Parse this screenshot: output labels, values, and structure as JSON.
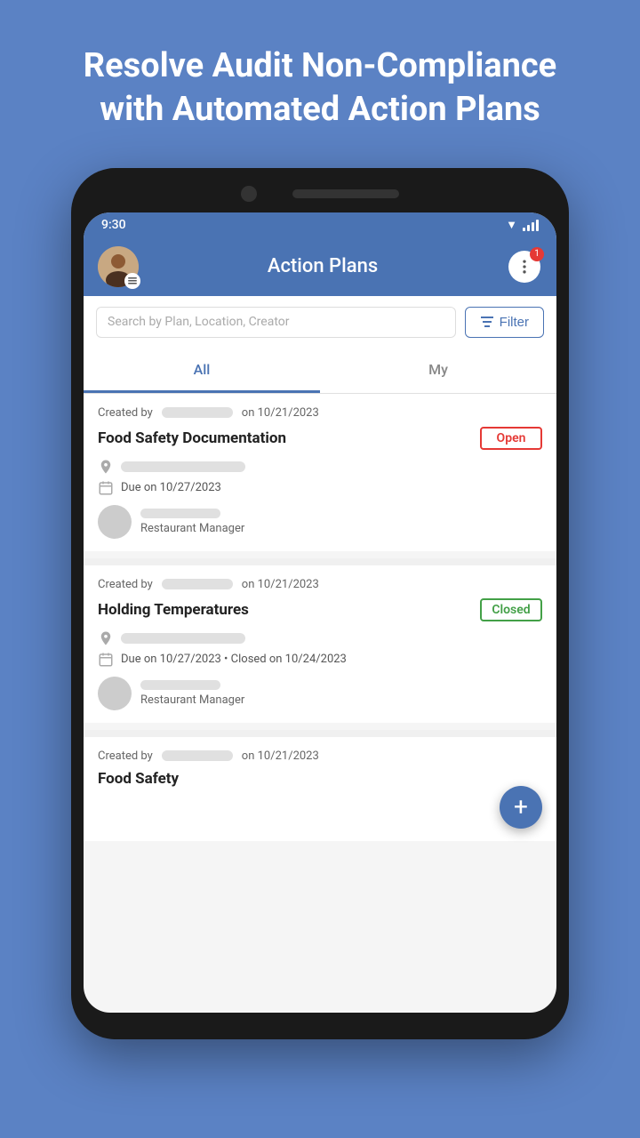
{
  "page": {
    "header_title": "Resolve Audit Non-Compliance with Automated Action Plans",
    "app_bar": {
      "title": "Action Plans",
      "notification_count": "1"
    },
    "search": {
      "placeholder": "Search by Plan, Location, Creator",
      "filter_label": "Filter"
    },
    "tabs": [
      {
        "id": "all",
        "label": "All",
        "active": true
      },
      {
        "id": "my",
        "label": "My",
        "active": false
      }
    ],
    "plans": [
      {
        "created_by_date": "on 10/21/2023",
        "title": "Food Safety Documentation",
        "status": "Open",
        "status_type": "open",
        "due_date": "Due on 10/27/2023",
        "closed_date": null,
        "assignee_role": "Restaurant Manager"
      },
      {
        "created_by_date": "on 10/21/2023",
        "title": "Holding Temperatures",
        "status": "Closed",
        "status_type": "closed",
        "due_date": "Due on 10/27/2023",
        "closed_date": "Closed on 10/24/2023",
        "assignee_role": "Restaurant Manager"
      },
      {
        "created_by_date": "on 10/21/2023",
        "title": "Food Safety",
        "status": null,
        "status_type": null,
        "due_date": null,
        "closed_date": null,
        "assignee_role": null
      }
    ],
    "status_bar": {
      "time": "9:30"
    }
  }
}
